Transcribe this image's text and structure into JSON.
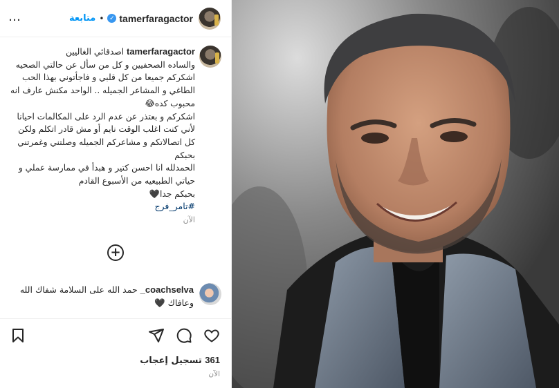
{
  "header": {
    "username": "tamerfaragactor",
    "follow_label": "متابعة",
    "dot": "•",
    "more_icon": "…",
    "verified_icon": "✓"
  },
  "caption": {
    "username": "tamerfaragactor",
    "text": "اصدقائي الغاليين\nوالساده الصحفيين و كل من سأل عن حالتي الصحيه اشكركم جميعا من كل قلبي و فاجأتوني بهذا الحب الطاغي و المشاعر الجميله .. الواحد مكنش عارف انه محبوب كده😂\nاشكركم و بعتذر عن عدم الرد على المكالمات احيانا لأني كنت اغلب الوقت نايم أو مش قادر اتكلم ولكن كل اتصالاتكم و مشاعركم الجميله وصلتني وغمرتني بحبكم\nالحمدلله انا احسن كتير و هبدأ في ممارسة عملي و حياتي الطبيعيه من الأسبوع القادم\nبحبكم جدا🖤",
    "hashtag": "#تامر_فرج",
    "time": "الآن"
  },
  "load_more": {
    "icon": "+"
  },
  "comment": {
    "username": "coachselva_",
    "text": " حمد الله على السلامة شفاك الله وعافاك 🖤"
  },
  "actions": {
    "like_icon": "heart-icon",
    "comment_icon": "comment-icon",
    "share_icon": "share-icon",
    "save_icon": "bookmark-icon"
  },
  "likes": {
    "count": "361",
    "label": "تسجيل إعجاب"
  },
  "footer": {
    "time": "الآن"
  },
  "colors": {
    "link": "#0095f6",
    "hashtag": "#00376b",
    "muted": "#8e8e8e",
    "verified": "#3897f0"
  }
}
